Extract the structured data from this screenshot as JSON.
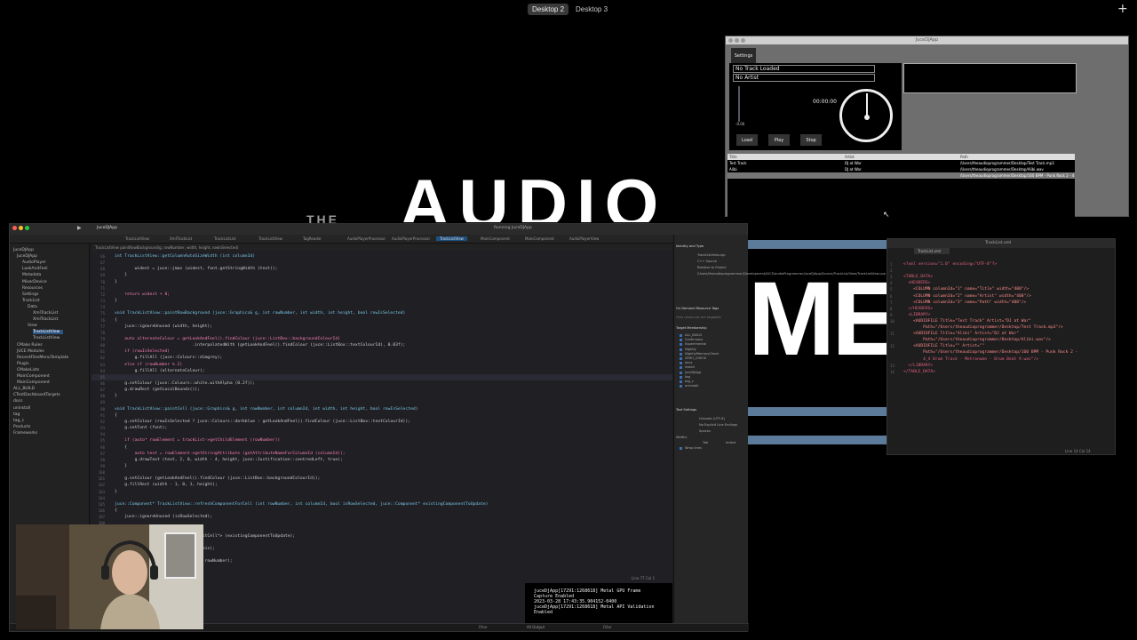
{
  "mission_control": {
    "desktops": [
      "Desktop 2",
      "Desktop 3"
    ],
    "add_symbol": "+"
  },
  "background_text": {
    "top_word": "AUDIO",
    "small_word": "THE",
    "big_word": "MER"
  },
  "app": {
    "title": "JuceDJApp",
    "settings_label": "Settings",
    "track_label": "No Track Loaded",
    "artist_label": "No Artist",
    "time": "00:00:00",
    "volume_value": "-0.00",
    "buttons": [
      "Load",
      "Play",
      "Stop"
    ],
    "table": {
      "headers": [
        "Title",
        "Artist",
        "Path"
      ],
      "rows": [
        [
          "Test Track",
          "DJ at War",
          "/Users/theaudioprogrammer/Desktop/Test Track.mp3"
        ],
        [
          "Alibi",
          "DJ at War",
          "/Users/theaudioprogrammer/Desktop/Alibi.wav"
        ],
        [
          "",
          "",
          "/Users/theaudioprogrammer/Desktop/160 BPM - Punk Rock 2 - 4_4 Drum Track - Met..."
        ]
      ]
    }
  },
  "xcode": {
    "project": "JuceDJApp",
    "run_status": "Running JuceDJApp",
    "breadcrumb": "TrackListView  paintRowBackground(g, rowNumber, width, height, rowIsSelected)",
    "tabs": [
      "TrackListView",
      "XmlTrackList",
      "TrackListList",
      "TrackListView",
      "TagReader",
      "AudioPlayerProcessor",
      "AudioPlayerProcessor",
      "TrackListView",
      "MainComponent",
      "MainComponent",
      "AudioPlayerView"
    ],
    "navigator": [
      "JuceDJApp",
      "JuceDJApp",
      "AudioPlayer",
      "LookAndFeel",
      "Metadata",
      "MixerDevice",
      "Resources",
      "Settings",
      "TrackList",
      "Data",
      "XmlTrackList",
      "XmlTrackList",
      "View",
      "TrackListView",
      "TrackListView",
      "CMake Rules",
      "JUCE Modules",
      "RecentFilesMenuTemplate",
      "Plugin",
      "CMakeLists",
      "MainComponent",
      "MainComponent",
      "ALL_BUILD",
      "CTestDashboardTargets",
      "docs",
      "uninstall",
      "tag",
      "tag_c",
      "Products",
      "Frameworks"
    ],
    "code": [
      {
        "n": "66",
        "t": "int TrackListView::getColumnAutoSizeWidth (int columnId)"
      },
      {
        "n": "67",
        "t": ""
      },
      {
        "n": "68",
        "t": "        widest = juce::jmax (widest, font.getStringWidth (text));"
      },
      {
        "n": "69",
        "t": "    }"
      },
      {
        "n": "70",
        "t": "}"
      },
      {
        "n": "71",
        "t": ""
      },
      {
        "n": "72",
        "t": "    return widest + 8;"
      },
      {
        "n": "73",
        "t": "}"
      },
      {
        "n": "74",
        "t": ""
      },
      {
        "n": "75",
        "t": "void TrackListView::paintRowBackground (juce::Graphics& g, int rowNumber, int width, int height, bool rowIsSelected)"
      },
      {
        "n": "76",
        "t": "{"
      },
      {
        "n": "77",
        "t": "    juce::ignoreUnused (width, height);"
      },
      {
        "n": "78",
        "t": ""
      },
      {
        "n": "79",
        "t": "    auto alternateColour = getLookAndFeel().findColour (juce::ListBox::backgroundColourId)"
      },
      {
        "n": "80",
        "t": "                               .interpolatedWith (getLookAndFeel().findColour (juce::ListBox::textColourId), 0.03f);"
      },
      {
        "n": "81",
        "t": "    if (rowIsSelected)"
      },
      {
        "n": "82",
        "t": "        g.fillAll (juce::Colours::dimgrey);"
      },
      {
        "n": "83",
        "t": "    else if (rowNumber % 2)"
      },
      {
        "n": "84",
        "t": "        g.fillAll (alternateColour);"
      },
      {
        "n": "85",
        "t": ""
      },
      {
        "n": "86",
        "t": "    g.setColour (juce::Colours::white.withAlpha (0.2f));"
      },
      {
        "n": "87",
        "t": "    g.drawRect (getLocalBounds());"
      },
      {
        "n": "88",
        "t": "}"
      },
      {
        "n": "89",
        "t": ""
      },
      {
        "n": "90",
        "t": "void TrackListView::paintCell (juce::Graphics& g, int rowNumber, int columnId, int width, int height, bool rowIsSelected)"
      },
      {
        "n": "91",
        "t": "{"
      },
      {
        "n": "92",
        "t": "    g.setColour (rowIsSelected ? juce::Colours::darkblue : getLookAndFeel().findColour (juce::ListBox::textColourId));"
      },
      {
        "n": "93",
        "t": "    g.setFont (font);"
      },
      {
        "n": "94",
        "t": ""
      },
      {
        "n": "95",
        "t": "    if (auto* rowElement = trackList->getChildElement (rowNumber))"
      },
      {
        "n": "96",
        "t": "    {"
      },
      {
        "n": "97",
        "t": "        auto text = rowElement->getStringAttribute (getAttributeNameForColumnId (columnId));"
      },
      {
        "n": "98",
        "t": "        g.drawText (text, 2, 0, width - 4, height, juce::Justification::centredLeft, true);"
      },
      {
        "n": "99",
        "t": "    }"
      },
      {
        "n": "100",
        "t": ""
      },
      {
        "n": "101",
        "t": "    g.setColour (getLookAndFeel().findColour (juce::ListBox::backgroundColourId));"
      },
      {
        "n": "102",
        "t": "    g.fillRect (width - 1, 0, 1, height);"
      },
      {
        "n": "103",
        "t": "}"
      },
      {
        "n": "104",
        "t": ""
      },
      {
        "n": "105",
        "t": "juce::Component* TrackListView::refreshComponentForCell (int rowNumber, int columnId, bool isRowSelected, juce::Component* existingComponentToUpdate)"
      },
      {
        "n": "106",
        "t": "{"
      },
      {
        "n": "107",
        "t": "    juce::ignoreUnused (isRowSelected);"
      },
      {
        "n": "108",
        "t": ""
      },
      {
        "n": "109",
        "t": ""
      },
      {
        "n": "110",
        "t": "                      _cast<TrackListCell*> (existingComponentToUpdate);"
      },
      {
        "n": "111",
        "t": ""
      },
      {
        "n": "112",
        "t": "                      kListCell (*this);"
      },
      {
        "n": "113",
        "t": ""
      },
      {
        "n": "114",
        "t": "                      ow (columnId, rowNumber);"
      }
    ],
    "inspector": {
      "sections": [
        "Identity and Type",
        "On Demand Resource Tags",
        "Target Membership",
        "Text Settings"
      ],
      "name": "TrackListView.cpp",
      "type": "C++ Source",
      "location": "Relative to Project",
      "full_path": "/Users/theaudioprogrammer/Development/JUCE/audioProgrammer/juceDjApp/Source/TrackList/View/TrackListView.cpp",
      "tags_placeholder": "Only resources are taggable",
      "targets": [
        "ALL_BUILD",
        "Continuous",
        "Experimental",
        "Nightly",
        "NightlyMemoryCheck",
        "ZERO_CHECK",
        "docs",
        "install",
        "juceDjApp",
        "tag",
        "tag_c",
        "uninstall"
      ],
      "text_encoding": "Unicode (UTF-8)",
      "line_endings": "No Explicit Line Endings",
      "indent_using": "Spaces",
      "widths_label": "Widths",
      "tab_label": "Tab",
      "indent_label": "Indent",
      "wrap_lines": "Wrap lines"
    },
    "console": [
      "juceDjApp[17291:1268618] Metal GPU Frame",
      "Capture Enabled",
      "2023-03-28 17:43:35.904152-0400",
      "juceDjApp[17291:1268618] Metal API Validation",
      "Enabled"
    ],
    "cursor_pos": "Line 77  Col 1",
    "output_label": "All Output",
    "filter_label": "Filter"
  },
  "xml_editor": {
    "filename": "TrackList.xml",
    "cursor_pos": "Line 14  Col 14",
    "lines": [
      "<?xml version=\"1.0\" encoding=\"UTF-8\"?>",
      "",
      "<TABLE_DATA>",
      "  <HEADERS>",
      "    <COLUMN columnId=\"1\" name=\"Title\" width=\"400\"/>",
      "    <COLUMN columnId=\"2\" name=\"Artist\" width=\"400\"/>",
      "    <COLUMN columnId=\"3\" name=\"Path\" width=\"400\"/>",
      "  </HEADERS>",
      "  <LIBRARY>",
      "    <AUDIOFILE Title=\"Test Track\" Artist=\"DJ at War\"",
      "        Path=\"/Users/theaudioprogrammer/Desktop/Test Track.mp3\"/>",
      "    <AUDIOFILE Title=\"Alibi\" Artist=\"DJ at War\"",
      "        Path=\"/Users/theaudioprogrammer/Desktop/Alibi.wav\"/>",
      "    <AUDIOFILE Title=\"\" Artist=\"\"",
      "        Path=\"/Users/theaudioprogrammer/Desktop/160 BPM - Punk Rock 2 -",
      "        4_4 Drum Track - Metronome - Drum Beat 9.wav\"/>",
      "  </LIBRARY>",
      "</TABLE_DATA>"
    ],
    "line_numbers": [
      "1",
      "2",
      "3",
      "4",
      "5",
      "6",
      "7",
      "8",
      "9",
      "10",
      "",
      "11",
      "",
      "12",
      "",
      "",
      "13",
      "14"
    ]
  },
  "colors": {
    "accent": "#2e5480",
    "selected_tab": "#1d4f80",
    "xml_tag": "#e0607e",
    "xml_attr": "#d9a35b",
    "xml_string": "#ff8a8a",
    "keyword": "#fc5fa3",
    "type": "#7ac7e6"
  }
}
